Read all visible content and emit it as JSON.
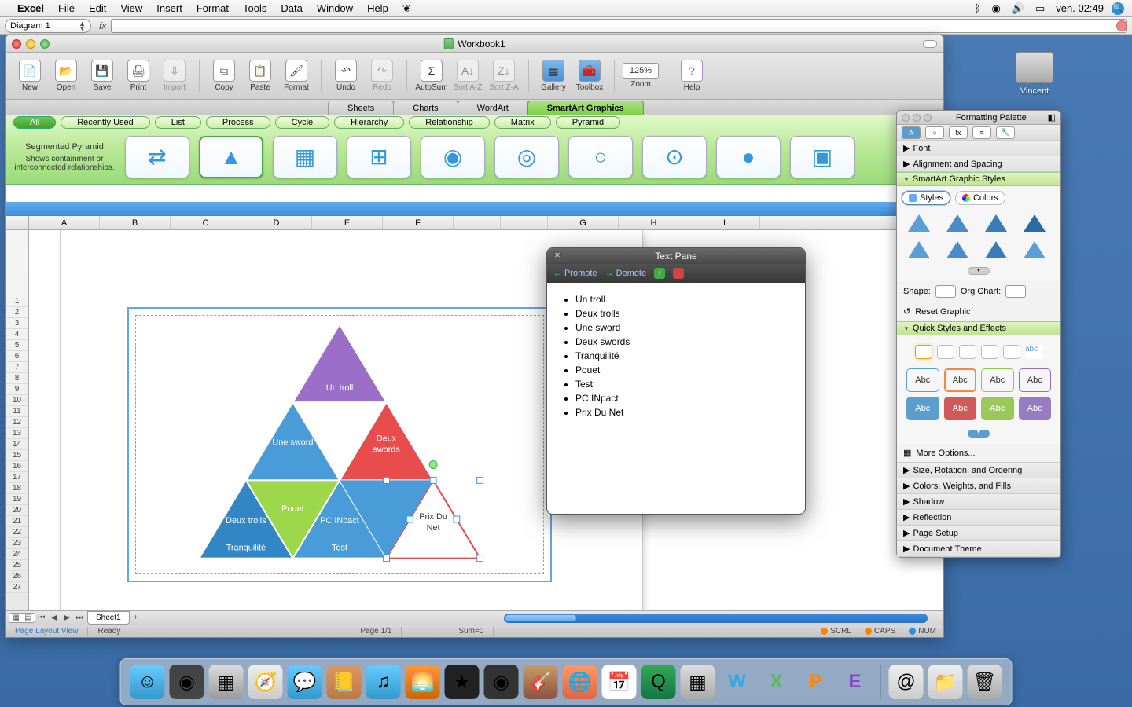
{
  "menubar": {
    "app": "Excel",
    "items": [
      "File",
      "Edit",
      "View",
      "Insert",
      "Format",
      "Tools",
      "Data",
      "Window",
      "Help"
    ],
    "clock": "ven. 02:49"
  },
  "namebox": {
    "value": "Diagram 1",
    "fx": "fx"
  },
  "window": {
    "title": "Workbook1"
  },
  "toolbar": {
    "new": "New",
    "open": "Open",
    "save": "Save",
    "print": "Print",
    "import": "Import",
    "copy": "Copy",
    "paste": "Paste",
    "format": "Format",
    "undo": "Undo",
    "redo": "Redo",
    "autosum": "AutoSum",
    "sortaz": "Sort A-Z",
    "sortza": "Sort Z-A",
    "gallery": "Gallery",
    "toolbox": "Toolbox",
    "zoom": "Zoom",
    "zoom_value": "125%",
    "help": "Help"
  },
  "doctabs": {
    "items": [
      "Sheets",
      "Charts",
      "WordArt",
      "SmartArt Graphics"
    ],
    "active": 3
  },
  "ribbon": {
    "cats": [
      "All",
      "Recently Used",
      "List",
      "Process",
      "Cycle",
      "Hierarchy",
      "Relationship",
      "Matrix",
      "Pyramid"
    ],
    "active": 0,
    "desc_title": "Segmented Pyramid",
    "desc_body": "Shows containment or interconnected relationships."
  },
  "smartart": {
    "items": [
      "Un troll",
      "Deux trolls",
      "Une sword",
      "Deux swords",
      "Tranquilité",
      "Pouet",
      "Test",
      "PC INpact",
      "Prix Du Net"
    ]
  },
  "textpane": {
    "title": "Text Pane",
    "promote": "Promote",
    "demote": "Demote"
  },
  "sheet": {
    "tab": "Sheet1",
    "cols": [
      "A",
      "B",
      "C",
      "D",
      "E",
      "F",
      "",
      "",
      "G",
      "H",
      "I"
    ]
  },
  "status": {
    "view": "Page Layout View",
    "state": "Ready",
    "page": "Page 1/1",
    "sum": "Sum=0",
    "scrl": "SCRL",
    "caps": "CAPS",
    "num": "NUM"
  },
  "palette": {
    "title": "Formatting Palette",
    "font": "Font",
    "align": "Alignment and Spacing",
    "sag": "SmartArt Graphic Styles",
    "styles_tab": "Styles",
    "colors_tab": "Colors",
    "shape_label": "Shape:",
    "orgchart_label": "Org Chart:",
    "reset": "Reset Graphic",
    "qse": "Quick Styles and Effects",
    "abc": "Abc",
    "more": "More Options...",
    "sections": [
      "Size, Rotation, and Ordering",
      "Colors, Weights, and Fills",
      "Shadow",
      "Reflection",
      "Page Setup",
      "Document Theme"
    ]
  },
  "desktop": {
    "hd": "Vincent"
  },
  "chart_data": {
    "type": "pyramid",
    "title": "Segmented Pyramid",
    "rows": [
      [
        "Un troll"
      ],
      [
        "Une sword",
        "Deux swords"
      ],
      [
        "Deux trolls",
        "PC INpact"
      ],
      [
        "Tranquilité",
        "Pouet",
        "Test",
        "Prix Du Net"
      ]
    ],
    "labels": [
      "Un troll",
      "Deux trolls",
      "Une sword",
      "Deux swords",
      "Tranquilité",
      "Pouet",
      "Test",
      "PC INpact",
      "Prix Du Net"
    ]
  }
}
